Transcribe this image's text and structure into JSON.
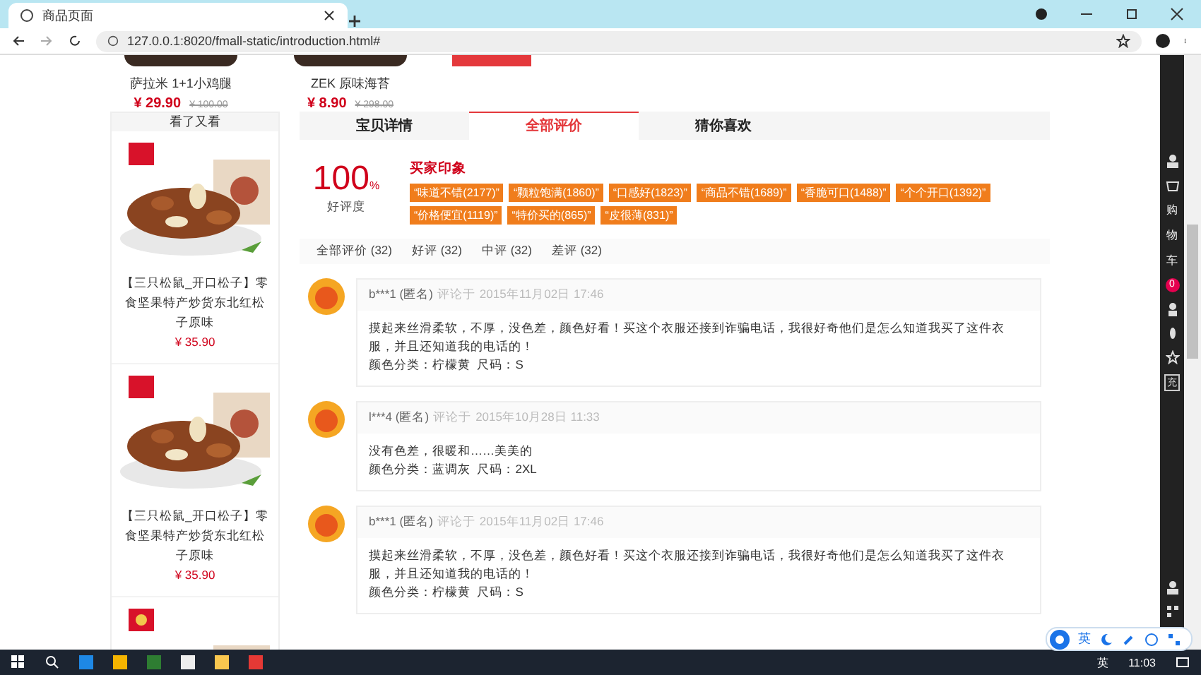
{
  "browser": {
    "tab_title": "商品页面",
    "url": "127.0.0.1:8020/fmall-static/introduction.html#"
  },
  "top_products": [
    {
      "name": "萨拉米 1+1小鸡腿",
      "price": "¥ 29.90",
      "old_price": "¥ 100.00"
    },
    {
      "name": "ZEK 原味海苔",
      "price": "¥ 8.90",
      "old_price": "¥ 298.00"
    }
  ],
  "sidebar": {
    "title": "看了又看",
    "products": [
      {
        "kind": "full",
        "name": "【三只松鼠_开口松子】零食坚果特产炒货东北红松子原味",
        "price": "¥ 35.90"
      },
      {
        "kind": "full",
        "name": "【三只松鼠_开口松子】零食坚果特产炒货东北红松子原味",
        "price": "¥ 35.90"
      },
      {
        "kind": "partial"
      }
    ]
  },
  "tabs": [
    {
      "label": "宝贝详情",
      "selected": false
    },
    {
      "label": "全部评价",
      "selected": true
    },
    {
      "label": "猜你喜欢",
      "selected": false
    }
  ],
  "rating": {
    "score": "100",
    "unit": "%",
    "label": "好评度"
  },
  "impressions": {
    "title": "买家印象",
    "tags": [
      "“味道不错(2177)”",
      "“颗粒饱满(1860)”",
      "“口感好(1823)”",
      "“商品不错(1689)”",
      "“香脆可口(1488)”",
      "“个个开口(1392)”",
      "“价格便宜(1119)”",
      "“特价买的(865)”",
      "“皮很薄(831)”"
    ]
  },
  "filters": [
    "全部评价 (32)",
    "好评 (32)",
    "中评 (32)",
    "差评 (32)"
  ],
  "reviews": [
    {
      "user": "b***1 (匿名)",
      "prefix": "评论于",
      "date": "2015年11月02日 17:46",
      "text": "摸起来丝滑柔软，不厚，没色差，颜色好看！买这个衣服还接到诈骗电话，我很好奇他们是怎么知道我买了这件衣服，并且还知道我的电话的！",
      "spec": "颜色分类：柠檬黄  尺码：S"
    },
    {
      "user": "l***4 (匿名)",
      "prefix": "评论于",
      "date": "2015年10月28日 11:33",
      "text": "没有色差，很暖和……美美的",
      "spec": "颜色分类：蓝调灰  尺码：2XL"
    },
    {
      "user": "b***1 (匿名)",
      "prefix": "评论于",
      "date": "2015年11月02日 17:46",
      "text": "摸起来丝滑柔软，不厚，没色差，颜色好看！买这个衣服还接到诈骗电话，我很好奇他们是怎么知道我买了这件衣服，并且还知道我的电话的！",
      "spec": "颜色分类：柠檬黄  尺码：S"
    }
  ],
  "right_bar": {
    "cart_label": [
      "购",
      "物",
      "车"
    ],
    "cart_count": "0",
    "recharge": "充"
  },
  "ime_bar": {
    "language": "英"
  },
  "taskbar": {
    "ime": "英",
    "time": "11:03"
  }
}
